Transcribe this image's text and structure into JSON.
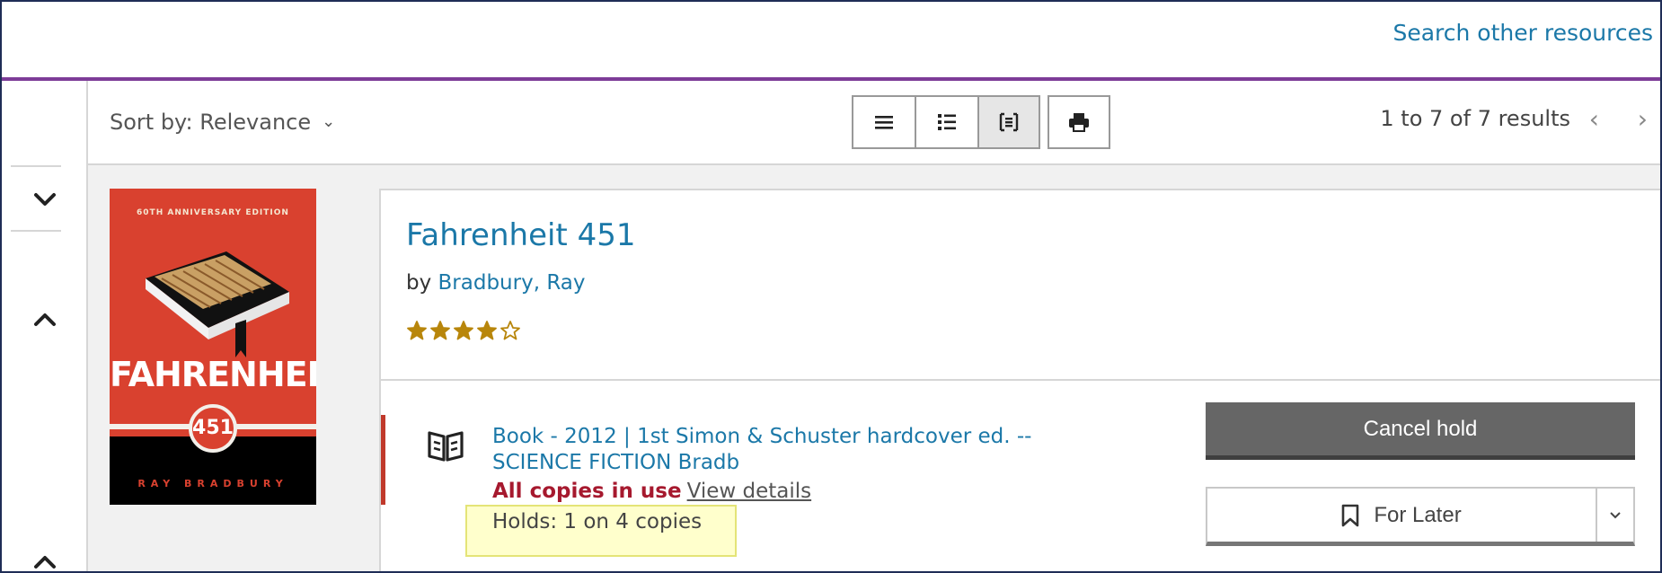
{
  "header": {
    "search_other_resources": "Search other resources"
  },
  "toolbar": {
    "sort_label": "Sort by: Relevance",
    "results_text": "1 to 7 of 7 results",
    "view_buttons": [
      "list-view-icon",
      "summary-view-icon",
      "grid-detail-view-icon"
    ],
    "active_view_index": 2,
    "print_icon": "print-icon"
  },
  "left_rail": {
    "icons": [
      "chevron-down-icon",
      "chevron-up-icon",
      "chevron-up-icon"
    ]
  },
  "result": {
    "cover": {
      "top_text": "60TH ANNIVERSARY EDITION",
      "title_text": "FAHRENHEIT",
      "number_text": "451",
      "author_text": "RAY BRADBURY"
    },
    "title": "Fahrenheit 451",
    "by": "by",
    "author": "Bradbury, Ray",
    "rating": 4,
    "rating_max": 5,
    "format_line": "Book - 2012 | 1st Simon & Schuster hardcover ed. --",
    "call_number": "SCIENCE FICTION Bradb",
    "availability": "All copies in use",
    "view_details": "View details",
    "holds": "Holds: 1 on 4 copies",
    "cancel_hold_label": "Cancel hold",
    "for_later_label": "For Later"
  },
  "colors": {
    "link": "#1b78a8",
    "accent_bar": "#7d3c98",
    "unavailable": "#a6192e",
    "star": "#b8860b",
    "highlight": "#ffffcc"
  }
}
